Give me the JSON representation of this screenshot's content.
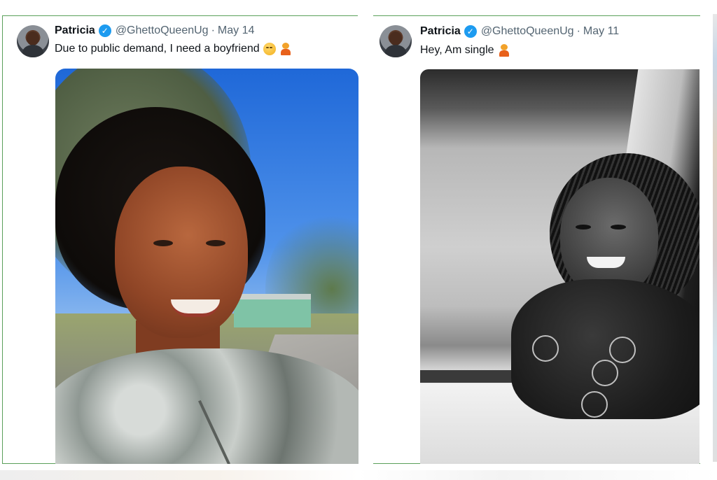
{
  "tweets": [
    {
      "author_name": "Patricia",
      "handle": "@GhettoQueenUg",
      "separator": "·",
      "date": "May 14",
      "text": "Due to public demand, I need a boyfriend",
      "emojis": [
        "smirking-face-emoji",
        "person-raising-hand-emoji"
      ],
      "image": "selfie-photo"
    },
    {
      "author_name": "Patricia",
      "handle": "@GhettoQueenUg",
      "separator": "·",
      "date": "May 11",
      "text": "Hey, Am single",
      "emojis": [
        "person-raising-hand-emoji"
      ],
      "image": "black-and-white-photo"
    }
  ],
  "colors": {
    "verified_badge": "#1d9bf0",
    "border": "#5aa05a",
    "name_text": "#0f1419",
    "meta_text": "#536471"
  }
}
